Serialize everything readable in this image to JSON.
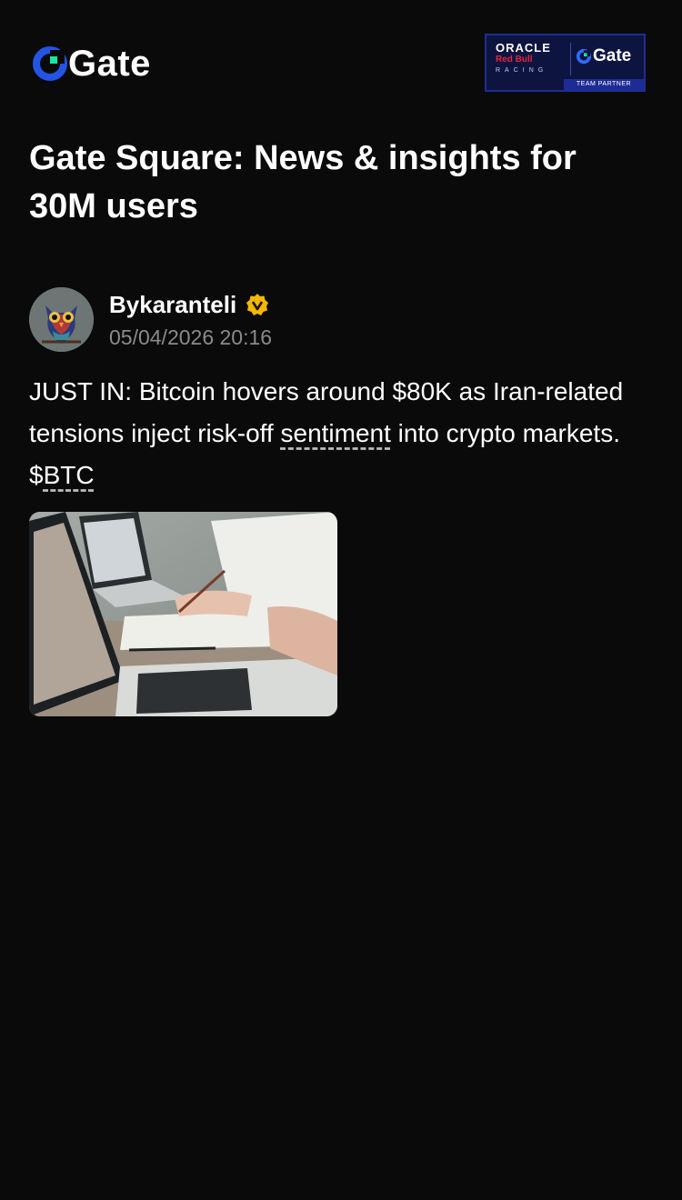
{
  "header": {
    "brand": "Gate",
    "partner_badge": {
      "line1": "ORACLE",
      "line2": "Red Bull",
      "line3": "RACING",
      "brand": "Gate",
      "tag": "TEAM PARTNER"
    }
  },
  "page_title": "Gate Square: News & insights for 30M users",
  "post": {
    "author": "Bykaranteli",
    "timestamp": "05/04/2026 20:16",
    "text_before": "JUST IN: Bitcoin hovers around $80K as Iran-related tensions inject risk-off ",
    "tag_sentiment": "sentiment",
    "text_middle": " into crypto markets. $",
    "tag_btc": "BTC"
  },
  "colors": {
    "background": "#0a0a0b",
    "brand_blue": "#2354e6",
    "brand_teal": "#17e6a1",
    "verified": "#f5b800",
    "muted_text": "#8a8a8f"
  }
}
